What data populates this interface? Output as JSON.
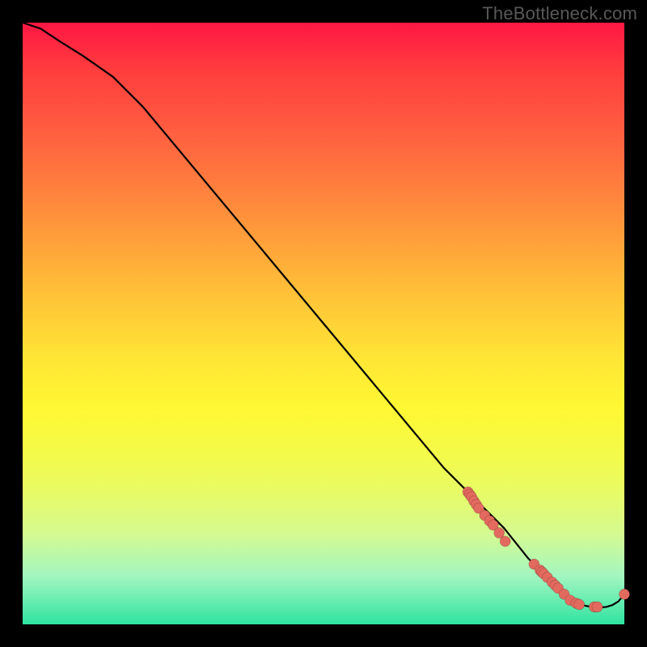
{
  "watermark": "TheBottleneck.com",
  "colors": {
    "background_frame": "#000000",
    "curve": "#000000",
    "dot_fill": "#e36a5e",
    "gradient_top": "#ff1744",
    "gradient_bottom": "#30e3a1"
  },
  "chart_data": {
    "type": "line",
    "title": "",
    "xlabel": "",
    "ylabel": "",
    "xlim": [
      0,
      100
    ],
    "ylim": [
      0,
      100
    ],
    "x": [
      0,
      3,
      6,
      10,
      15,
      20,
      25,
      30,
      35,
      40,
      45,
      50,
      55,
      60,
      65,
      70,
      74,
      78,
      80,
      82,
      84,
      85,
      86,
      87,
      88,
      89,
      90,
      91,
      92,
      93,
      94,
      95,
      96,
      97,
      98,
      99,
      100
    ],
    "values": [
      100,
      99,
      97,
      94.5,
      91,
      86,
      80,
      74,
      68,
      62,
      56,
      50,
      44,
      38,
      32,
      26,
      22,
      18,
      16,
      13.5,
      11,
      10,
      9,
      8,
      7,
      6,
      5,
      4,
      3.5,
      3.2,
      3.0,
      2.9,
      2.8,
      2.9,
      3.2,
      3.8,
      5
    ],
    "markers_x": [
      74,
      74.3,
      74.6,
      75,
      75.4,
      75.8,
      76.8,
      77.6,
      78.2,
      79.2,
      80.2,
      85,
      86,
      86.3,
      86.6,
      87.2,
      88,
      88.5,
      89,
      90,
      91,
      92,
      92.5,
      95,
      95.5,
      100
    ],
    "markers_y": [
      22,
      21.6,
      21.2,
      20.5,
      19.9,
      19.3,
      18.1,
      17.2,
      16.5,
      15.2,
      13.8,
      10,
      9,
      8.7,
      8.4,
      7.8,
      7,
      6.5,
      6,
      5,
      4,
      3.5,
      3.3,
      2.9,
      2.9,
      5
    ]
  }
}
